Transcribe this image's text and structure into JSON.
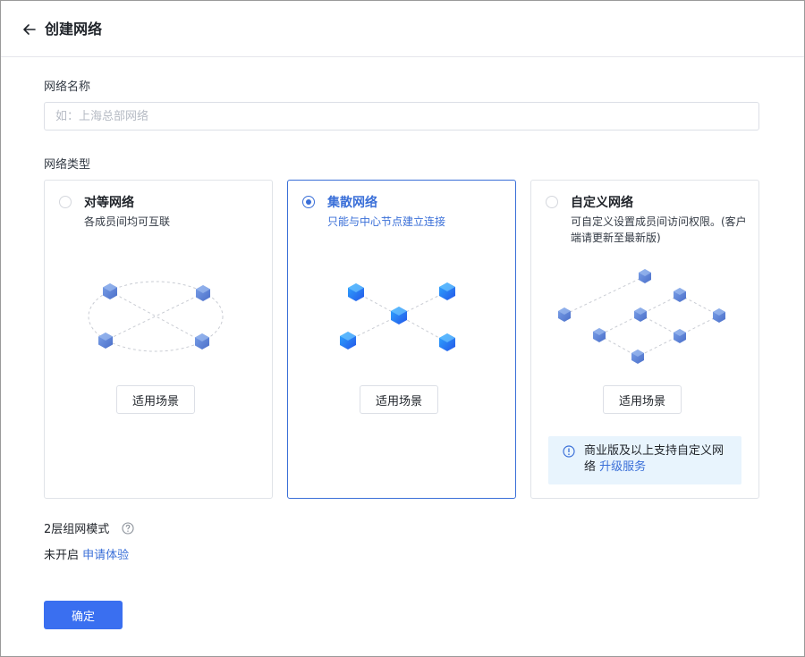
{
  "header": {
    "back_icon": "arrow-left-icon",
    "title": "创建网络"
  },
  "form": {
    "name_label": "网络名称",
    "name_placeholder": "如：上海总部网络",
    "name_value": "",
    "type_label": "网络类型"
  },
  "network_types": [
    {
      "title": "对等网络",
      "desc": "各成员间均可互联",
      "selected": false,
      "button_label": "适用场景"
    },
    {
      "title": "集散网络",
      "desc": "只能与中心节点建立连接",
      "selected": true,
      "button_label": "适用场景"
    },
    {
      "title": "自定义网络",
      "desc": "可自定义设置成员间访问权限。(客户端请更新至最新版)",
      "selected": false,
      "button_label": "适用场景",
      "notice_icon": "info-icon",
      "notice_text": "商业版及以上支持自定义网络",
      "notice_link": "升级服务"
    }
  ],
  "mode": {
    "label": "2层组网模式",
    "help_icon": "question-circle-icon",
    "status": "未开启",
    "apply_link": "申请体验"
  },
  "confirm_label": "确定",
  "colors": {
    "accent": "#3a6fd8",
    "button": "#3a6ff0",
    "notice_bg": "#e8f4fd"
  }
}
